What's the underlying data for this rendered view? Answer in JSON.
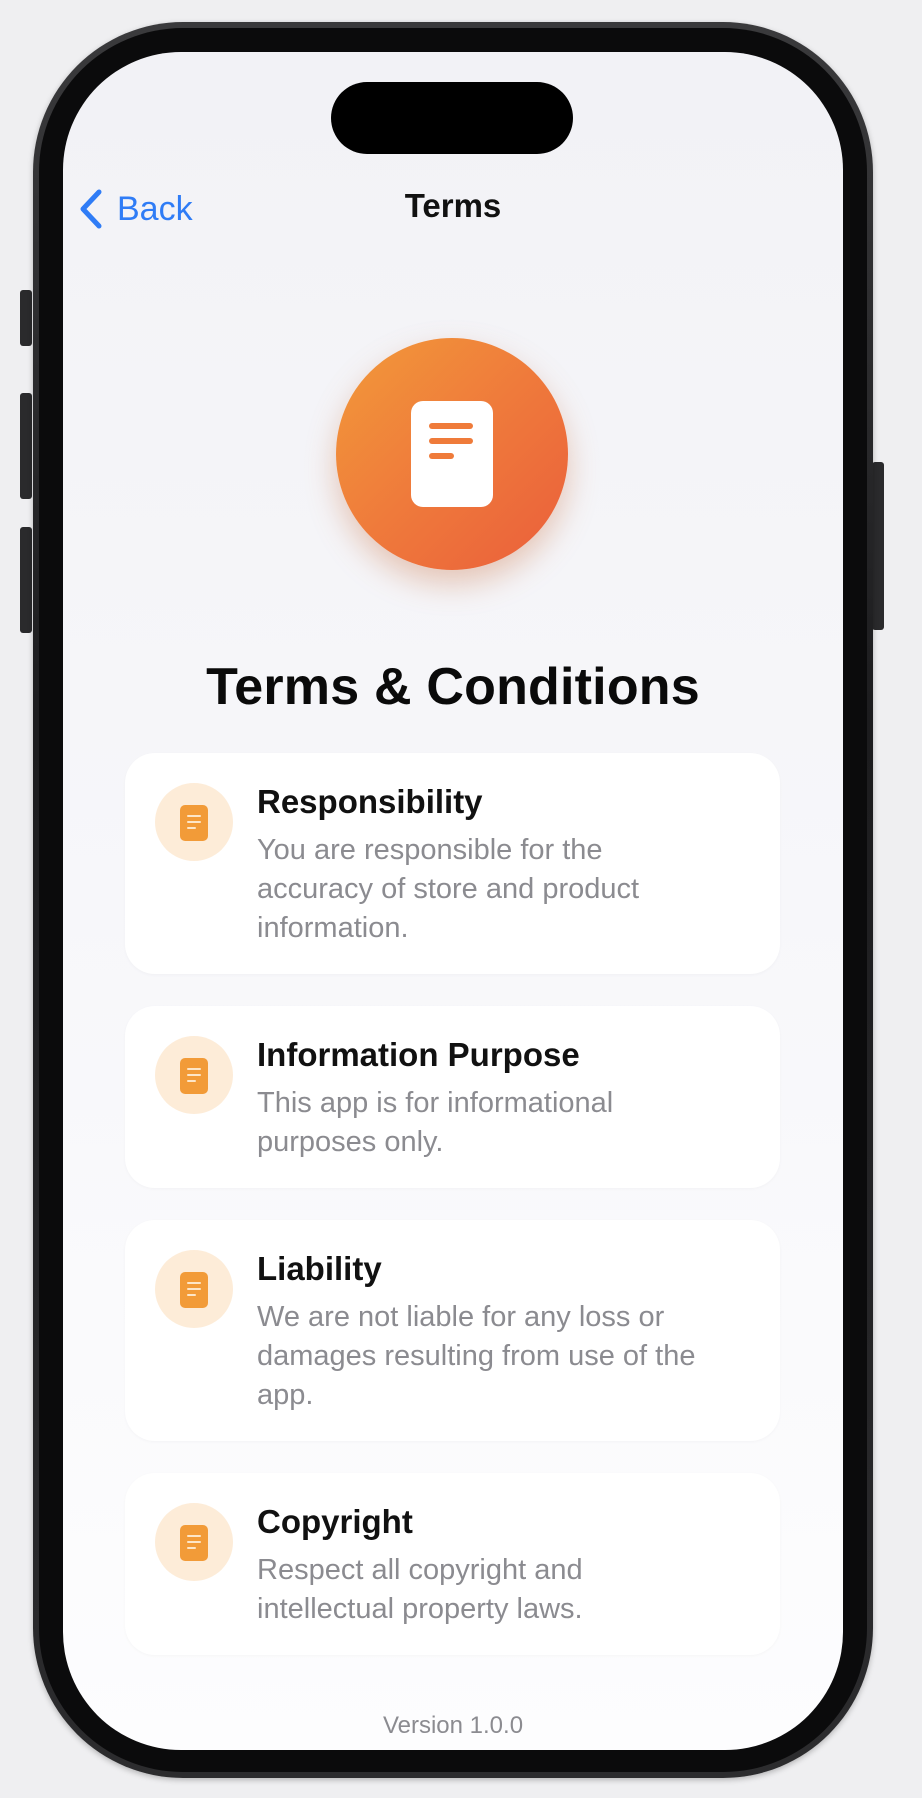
{
  "nav": {
    "back_label": "Back",
    "title": "Terms"
  },
  "hero": {
    "icon": "document-icon",
    "title": "Terms & Conditions",
    "gradient": [
      "#f29a3a",
      "#ea5e3b"
    ]
  },
  "sections": [
    {
      "title": "Responsibility",
      "description": "You are responsible for the accuracy of store and product information.",
      "icon": "document-icon"
    },
    {
      "title": "Information Purpose",
      "description": "This app is for informational purposes only.",
      "icon": "document-icon"
    },
    {
      "title": "Liability",
      "description": "We are not liable for any loss or damages resulting from use of the app.",
      "icon": "document-icon"
    },
    {
      "title": "Copyright",
      "description": "Respect all copyright and intellectual property laws.",
      "icon": "document-icon"
    }
  ],
  "footer": {
    "version": "Version 1.0.0"
  },
  "colors": {
    "accent_blue": "#2f7cf6",
    "accent_orange": "#f29b38",
    "icon_bg": "#fdecd8"
  }
}
